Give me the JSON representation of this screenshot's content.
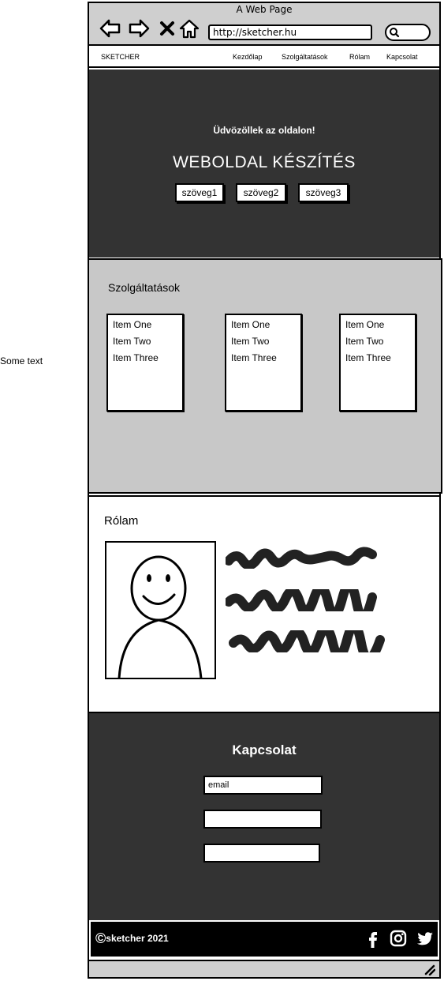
{
  "side_note": "Some text",
  "browser": {
    "window_title": "A Web Page",
    "url": "http://sketcher.hu"
  },
  "navbar": {
    "brand": "SKETCHER",
    "links": [
      "Kezdőlap",
      "Szolgáltatások",
      "Rólam",
      "Kapcsolat"
    ]
  },
  "hero": {
    "welcome": "Üdvözöllek az oldalon!",
    "title": "WEBOLDAL KÉSZÍTÉS",
    "buttons": [
      "szöveg1",
      "szöveg2",
      "szöveg3"
    ]
  },
  "services": {
    "heading": "Szolgáltatások",
    "lists": [
      [
        "Item One",
        "Item Two",
        "Item Three"
      ],
      [
        "Item One",
        "Item Two",
        "Item Three"
      ],
      [
        "Item One",
        "Item Two",
        "Item Three"
      ]
    ]
  },
  "about": {
    "heading": "Rólam"
  },
  "contact": {
    "heading": "Kapcsolat",
    "email_placeholder": "email"
  },
  "footer": {
    "copyright": "sketcher 2021"
  },
  "colors": {
    "dark_section": "#333333",
    "services_bg": "#c8c8c8",
    "chrome_bg": "#cfcfcf"
  }
}
